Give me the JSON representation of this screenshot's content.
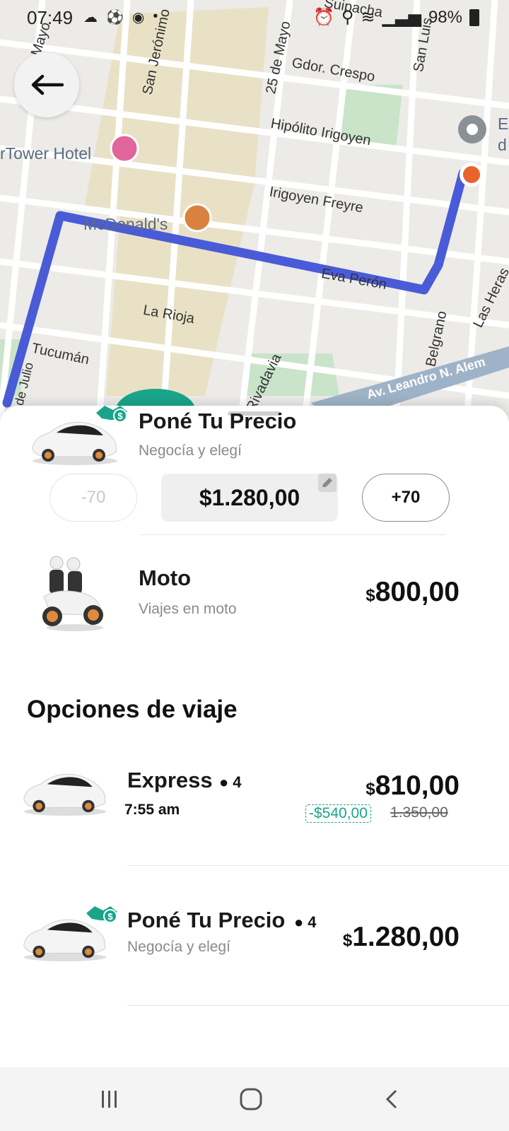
{
  "status_bar": {
    "time": "07:49",
    "battery": "98%"
  },
  "map": {
    "labels": [
      "Mayo",
      "San Jerónimo",
      "25 de Mayo",
      "Suipacha",
      "Gdor. Crespo",
      "Hipólito Irigoyen",
      "rTower Hotel",
      "Irigoyen Freyre",
      "McDonald's",
      "Eva Perón",
      "La Rioja",
      "Belgrano",
      "Las Heras",
      "Tucumán",
      "Rivadavia",
      "Av. Leandro N. Alem",
      "9 de Julio",
      "San Luis",
      "E",
      "d"
    ]
  },
  "selected": {
    "title": "Poné Tu Precio",
    "subtitle": "Negocía y elegí",
    "minus_label": "-70",
    "price": "$1.280,00",
    "plus_label": "+70"
  },
  "moto": {
    "title": "Moto",
    "subtitle": "Viajes en moto",
    "currency": "$",
    "price": "800,00"
  },
  "section_title": "Opciones de viaje",
  "options": [
    {
      "title": "Express",
      "seats": "4",
      "eta": "7:55 am",
      "currency": "$",
      "price": "810,00",
      "discount": "-$540,00",
      "old_price": "1.350,00"
    },
    {
      "title": "Poné Tu Precio",
      "seats": "4",
      "subtitle": "Negocía y elegí",
      "currency": "$",
      "price": "1.280,00"
    }
  ],
  "colors": {
    "route": "#4a5bd8",
    "accent": "#1aa58a",
    "dest_marker": "#e8642c"
  }
}
